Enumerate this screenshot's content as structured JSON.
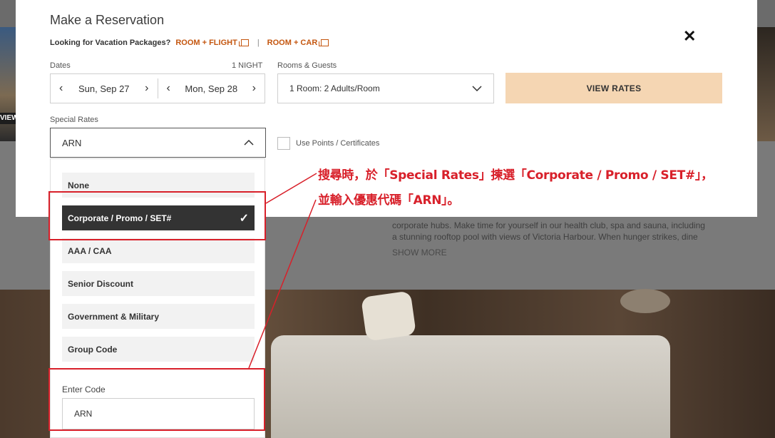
{
  "background": {
    "view_tag": "VIEW",
    "description_lines": [
      "corporate hubs. Make time for yourself in our health club, spa and sauna, including",
      "a stunning rooftop pool with views of Victoria Harbour. When hunger strikes, dine"
    ],
    "show_more": "SHOW MORE"
  },
  "modal": {
    "title": "Make a Reservation",
    "packages_label": "Looking for Vacation Packages?",
    "room_flight": "ROOM + FLIGHT",
    "separator": "|",
    "room_car": "ROOM + CAR",
    "close": "✕",
    "dates_label": "Dates",
    "nights": "1 NIGHT",
    "checkin": "Sun, Sep 27",
    "checkout": "Mon, Sep 28",
    "rooms_label": "Rooms & Guests",
    "rooms_value": "1 Room: 2 Adults/Room",
    "view_rates": "VIEW RATES",
    "special_label": "Special Rates",
    "special_value": "ARN",
    "points_label": "Use Points / Certificates"
  },
  "dropdown": {
    "options": [
      "None",
      "Corporate / Promo / SET#",
      "AAA / CAA",
      "Senior Discount",
      "Government & Military",
      "Group Code"
    ],
    "selected_check": "✓",
    "code_label": "Enter Code",
    "code_value": "ARN"
  },
  "annotation": {
    "line1": "搜尋時，於「Special Rates」揀選「Corporate / Promo / SET#」，",
    "line2": "並輸入優惠代碼「ARN」。",
    "color": "#d8202a"
  },
  "colors": {
    "accent_orange": "#c4560f",
    "view_rates_bg": "#f5d6b3",
    "selected_bg": "#333333"
  }
}
